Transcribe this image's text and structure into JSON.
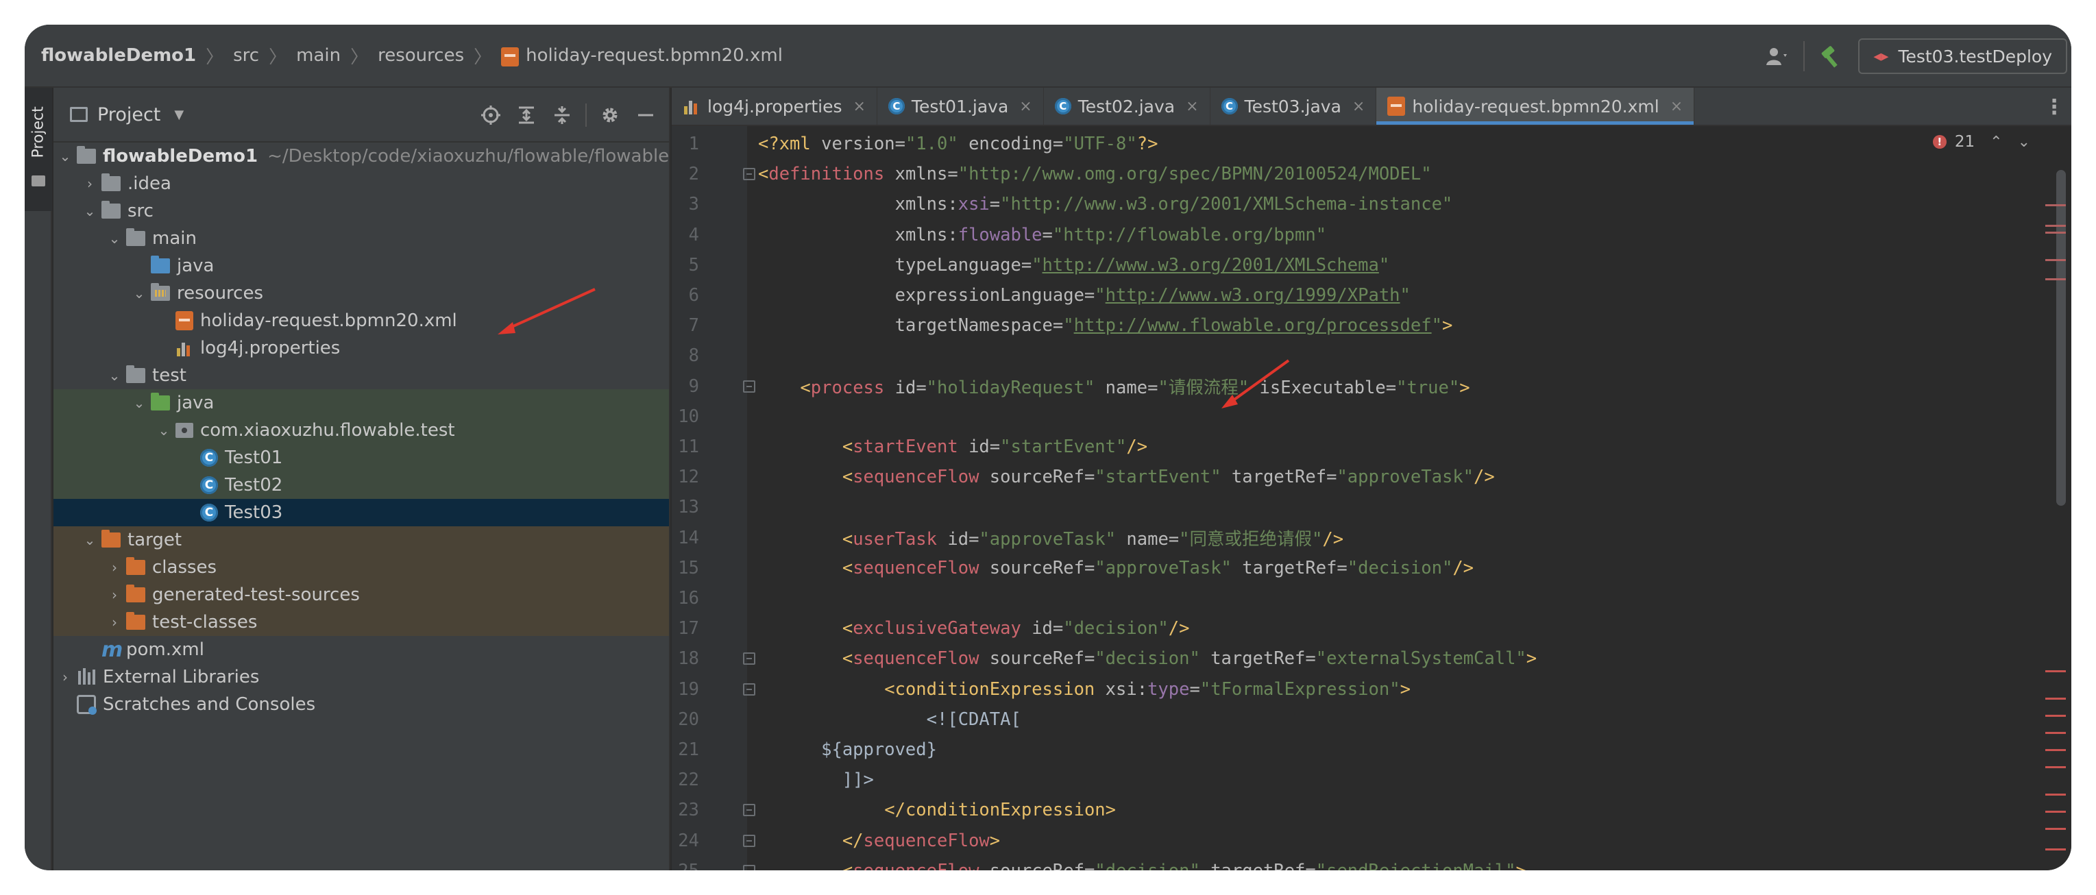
{
  "navbar": {
    "project": "flowableDemo1",
    "crumbs": [
      "src",
      "main",
      "resources",
      "holiday-request.bpmn20.xml"
    ],
    "run_config": "Test03.testDeploy",
    "icons": [
      "user-icon",
      "dropdown-icon",
      "build-hammer-icon",
      "run-config-icon"
    ]
  },
  "tool_stripe": {
    "label": "Project"
  },
  "project_panel": {
    "title": "Project",
    "tools": [
      "locate-icon",
      "expand-all-icon",
      "collapse-all-icon",
      "settings-gear-icon",
      "hide-icon"
    ],
    "tree": [
      {
        "label": "flowableDemo1",
        "path": "~/Desktop/code/xiaoxuzhu/flowable/flowableD"
      },
      {
        "label": ".idea"
      },
      {
        "label": "src"
      },
      {
        "label": "main"
      },
      {
        "label": "java"
      },
      {
        "label": "resources"
      },
      {
        "label": "holiday-request.bpmn20.xml"
      },
      {
        "label": "log4j.properties"
      },
      {
        "label": "test"
      },
      {
        "label": "java"
      },
      {
        "label": "com.xiaoxuzhu.flowable.test"
      },
      {
        "label": "Test01"
      },
      {
        "label": "Test02"
      },
      {
        "label": "Test03"
      },
      {
        "label": "target"
      },
      {
        "label": "classes"
      },
      {
        "label": "generated-test-sources"
      },
      {
        "label": "test-classes"
      },
      {
        "label": "pom.xml"
      },
      {
        "label": "External Libraries"
      },
      {
        "label": "Scratches and Consoles"
      }
    ]
  },
  "editor": {
    "tabs": [
      {
        "label": "log4j.properties"
      },
      {
        "label": "Test01.java"
      },
      {
        "label": "Test02.java"
      },
      {
        "label": "Test03.java"
      },
      {
        "label": "holiday-request.bpmn20.xml",
        "active": true
      }
    ],
    "inspections": {
      "errors": "21"
    },
    "colors": {
      "tag": "#e8bf6a",
      "value": "#6a8759",
      "namespace": "#9876aa",
      "error": "#c75450",
      "accent": "#4a88c7"
    },
    "lines": [
      {
        "n": "1",
        "t": "<?xml version=\"1.0\" encoding=\"UTF-8\"?>"
      },
      {
        "n": "2",
        "t": "<definitions xmlns=\"http://www.omg.org/spec/BPMN/20100524/MODEL\""
      },
      {
        "n": "3",
        "t": "             xmlns:xsi=\"http://www.w3.org/2001/XMLSchema-instance\""
      },
      {
        "n": "4",
        "t": "             xmlns:flowable=\"http://flowable.org/bpmn\""
      },
      {
        "n": "5",
        "t": "             typeLanguage=\"http://www.w3.org/2001/XMLSchema\""
      },
      {
        "n": "6",
        "t": "             expressionLanguage=\"http://www.w3.org/1999/XPath\""
      },
      {
        "n": "7",
        "t": "             targetNamespace=\"http://www.flowable.org/processdef\">"
      },
      {
        "n": "8",
        "t": ""
      },
      {
        "n": "9",
        "t": "    <process id=\"holidayRequest\" name=\"请假流程\" isExecutable=\"true\">"
      },
      {
        "n": "10",
        "t": ""
      },
      {
        "n": "11",
        "t": "        <startEvent id=\"startEvent\"/>"
      },
      {
        "n": "12",
        "t": "        <sequenceFlow sourceRef=\"startEvent\" targetRef=\"approveTask\"/>"
      },
      {
        "n": "13",
        "t": ""
      },
      {
        "n": "14",
        "t": "        <userTask id=\"approveTask\" name=\"同意或拒绝请假\"/>"
      },
      {
        "n": "15",
        "t": "        <sequenceFlow sourceRef=\"approveTask\" targetRef=\"decision\"/>"
      },
      {
        "n": "16",
        "t": ""
      },
      {
        "n": "17",
        "t": "        <exclusiveGateway id=\"decision\"/>"
      },
      {
        "n": "18",
        "t": "        <sequenceFlow sourceRef=\"decision\" targetRef=\"externalSystemCall\">"
      },
      {
        "n": "19",
        "t": "            <conditionExpression xsi:type=\"tFormalExpression\">"
      },
      {
        "n": "20",
        "t": "                <![CDATA["
      },
      {
        "n": "21",
        "t": "      ${approved}"
      },
      {
        "n": "22",
        "t": "        ]]>"
      },
      {
        "n": "23",
        "t": "            </conditionExpression>"
      },
      {
        "n": "24",
        "t": "        </sequenceFlow>"
      },
      {
        "n": "25",
        "t": "        <sequenceFlow sourceRef=\"decision\" targetRef=\"sendRejectionMail\">"
      }
    ]
  }
}
